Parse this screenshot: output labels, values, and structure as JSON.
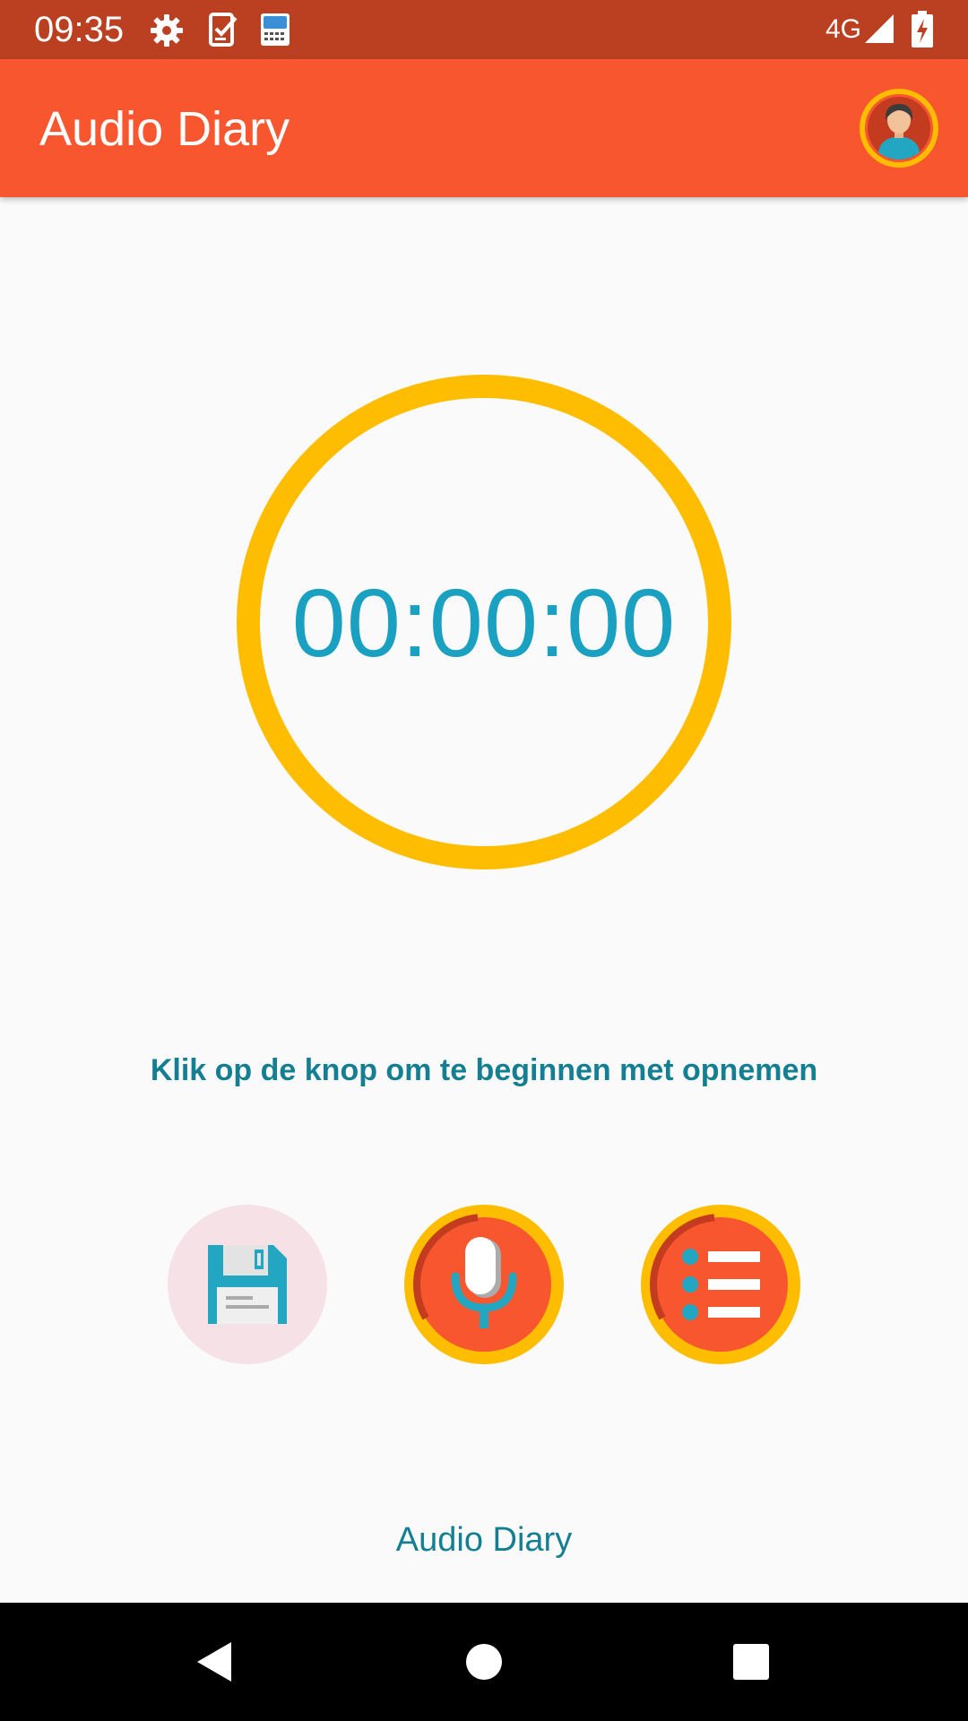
{
  "status_bar": {
    "time": "09:35",
    "network": "4G",
    "icons": [
      "settings-icon",
      "task-icon",
      "test-app-icon",
      "signal-icon",
      "battery-charging-icon"
    ]
  },
  "app_bar": {
    "title": "Audio Diary",
    "avatar_icon": "user-avatar-icon"
  },
  "timer": {
    "value": "00:00:00"
  },
  "hint": "Klik op de knop om te beginnen met opnemen",
  "actions": [
    {
      "name": "save",
      "icon": "floppy-disk-icon",
      "enabled": false
    },
    {
      "name": "record",
      "icon": "microphone-icon",
      "enabled": true
    },
    {
      "name": "list",
      "icon": "list-icon",
      "enabled": true
    }
  ],
  "footer": "Audio Diary",
  "nav": [
    "back-icon",
    "home-icon",
    "recents-icon"
  ],
  "colors": {
    "status_bar": "#bb3f21",
    "app_bar": "#f7562f",
    "accent": "#ffbd00",
    "timer_text": "#1aa0c0",
    "hint_text": "#147f92",
    "disabled_button": "#f5e1e6"
  }
}
